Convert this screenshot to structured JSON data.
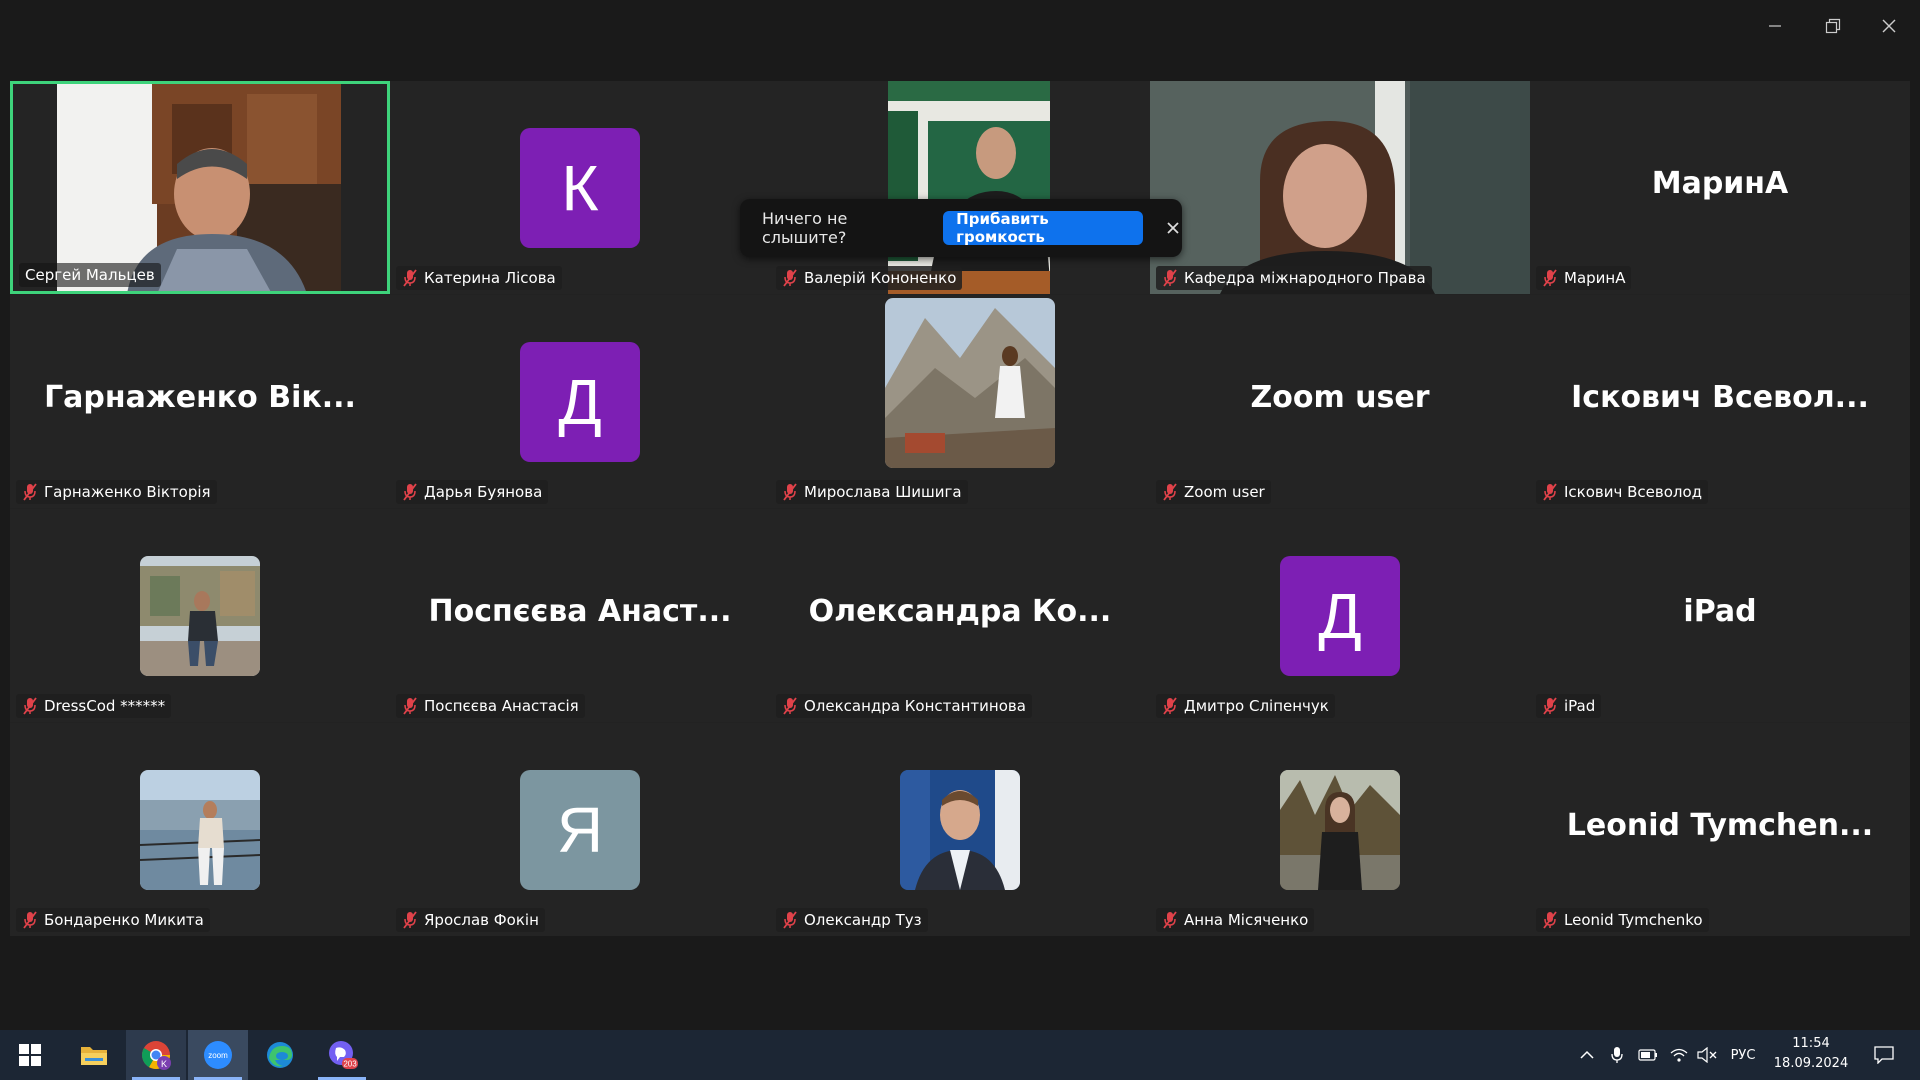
{
  "window": {
    "controls": [
      "minimize",
      "restore",
      "close"
    ]
  },
  "tiles": [
    {
      "name": "Сергей Мальцев",
      "kind": "video",
      "active": true,
      "muted": false
    },
    {
      "name": "Катерина Лісова",
      "kind": "avatar",
      "initial": "К",
      "avatar_color": "#7d1fb4",
      "muted": true
    },
    {
      "name": "Валерій Кононенко",
      "kind": "video",
      "muted": true
    },
    {
      "name": "Кафедра міжнародного Права",
      "kind": "video",
      "muted": true
    },
    {
      "name": "МаринА",
      "kind": "text",
      "display": "МаринА",
      "muted": true
    },
    {
      "name": "Гарнаженко Вікторія",
      "kind": "text",
      "display": "Гарнаженко Вік...",
      "muted": true
    },
    {
      "name": "Дарья Буянова",
      "kind": "avatar",
      "initial": "Д",
      "avatar_color": "#7d1fb4",
      "muted": true
    },
    {
      "name": "Мирослава Шишига",
      "kind": "photo",
      "muted": true
    },
    {
      "name": "Zoom user",
      "kind": "text",
      "display": "Zoom user",
      "muted": true
    },
    {
      "name": "Іскович Всеволод",
      "kind": "text",
      "display": "Іскович Всевол...",
      "muted": true
    },
    {
      "name": "DressCod ******",
      "kind": "photo",
      "muted": true
    },
    {
      "name": "Поспєєва Анастасія",
      "kind": "text",
      "display": "Поспєєва Анаст...",
      "muted": true
    },
    {
      "name": "Олександра Константинова",
      "kind": "text",
      "display": "Олександра Ко...",
      "muted": true
    },
    {
      "name": "Дмитро Сліпенчук",
      "kind": "avatar",
      "initial": "Д",
      "avatar_color": "#7d1fb4",
      "muted": true
    },
    {
      "name": "iPad",
      "kind": "text",
      "display": "iPad",
      "muted": true
    },
    {
      "name": "Бондаренко Микита",
      "kind": "photo",
      "muted": true
    },
    {
      "name": "Ярослав Фокін",
      "kind": "avatar",
      "initial": "Я",
      "avatar_color": "#7c96a0",
      "muted": true
    },
    {
      "name": "Олександр Туз",
      "kind": "photo",
      "muted": true
    },
    {
      "name": "Анна Місяченко",
      "kind": "photo",
      "muted": true
    },
    {
      "name": "Leonid Tymchenko",
      "kind": "text",
      "display": "Leonid Tymchen...",
      "muted": true
    }
  ],
  "tooltip": {
    "message": "Ничего не слышите?",
    "button_label": "Прибавить громкость",
    "close_icon": "close-icon"
  },
  "taskbar": {
    "apps": [
      "windows-start-icon",
      "file-explorer-icon",
      "chrome-icon",
      "zoom-icon",
      "edge-icon",
      "viber-icon"
    ],
    "zoom_label": "zoom",
    "chrome_badge": "K",
    "viber_badge": "203",
    "language": "РУС",
    "time": "11:54",
    "date": "18.09.2024"
  },
  "colors": {
    "active_speaker_border": "#3ed37b",
    "primary_button": "#0e72ed",
    "avatar_purple": "#7d1fb4",
    "avatar_gray": "#7c96a0",
    "muted_mic": "#e0424a"
  }
}
